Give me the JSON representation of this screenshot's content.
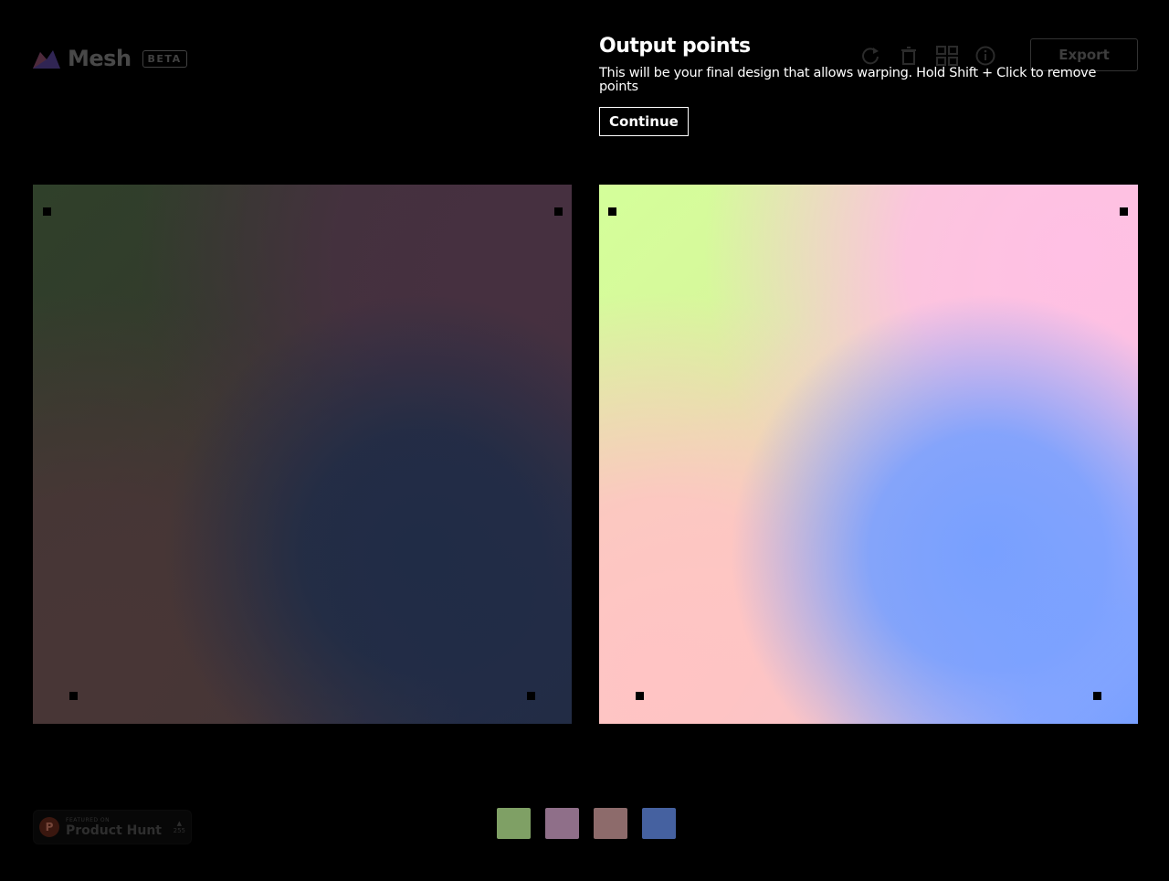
{
  "app": {
    "name": "Mesh",
    "badge": "BETA"
  },
  "toolbar": {
    "icons": [
      "refresh-icon",
      "trash-icon",
      "grid-icon",
      "info-icon"
    ],
    "export_label": "Export"
  },
  "overlay": {
    "title": "Output points",
    "description": "This will be your final design that allows warping. Hold Shift + Click to remove points",
    "continue_label": "Continue"
  },
  "product_hunt": {
    "featured": "FEATURED ON",
    "name": "Product Hunt",
    "votes": "255"
  },
  "swatches": [
    "#7fa065",
    "#8f6f89",
    "#8d6b6b",
    "#4561a0"
  ]
}
